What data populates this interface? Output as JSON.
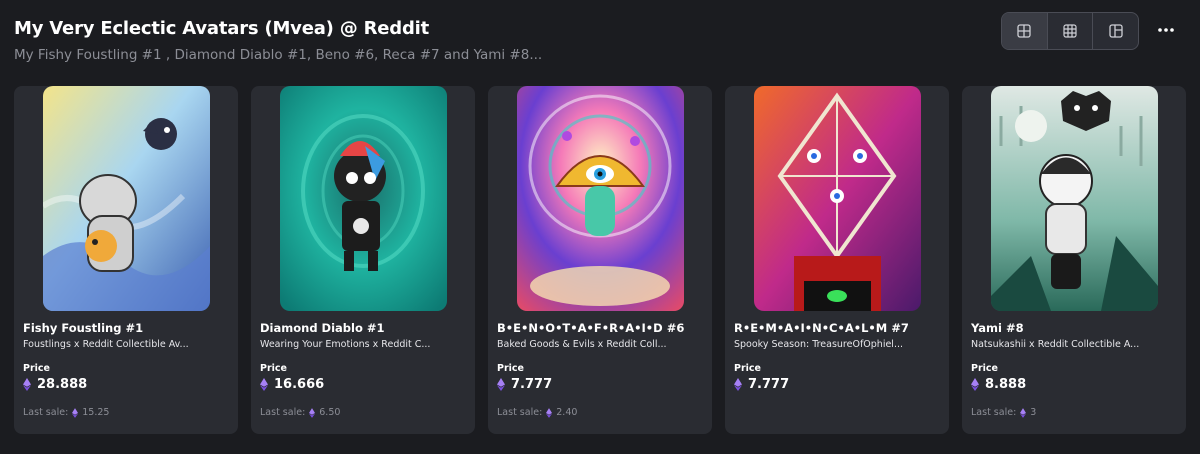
{
  "header": {
    "title": "My Very Eclectic Avatars (Mvea) @ Reddit",
    "subtitle": "My Fishy Foustling #1 , Diamond Diablo #1, Beno #6, Reca #7 and Yami #8..."
  },
  "toolbar": {
    "views": [
      {
        "icon": "grid-large-icon"
      },
      {
        "icon": "grid-small-icon"
      },
      {
        "icon": "layout-mosaic-icon"
      }
    ],
    "more_icon": "more-horizontal-icon"
  },
  "colors": {
    "accent": "#8a5cf6",
    "card_bg": "#2a2c32",
    "page_bg": "#1b1c20"
  },
  "price_label": "Price",
  "last_sale_label": "Last sale:",
  "cards": [
    {
      "name": "Fishy Foustling #1",
      "collection": "Foustlings x Reddit Collectible Av...",
      "price": "28.888",
      "last_sale": "15.25"
    },
    {
      "name": "Diamond Diablo #1",
      "collection": "Wearing Your Emotions x Reddit C...",
      "price": "16.666",
      "last_sale": "6.50"
    },
    {
      "name": "B•E•N•O•T•A•F•R•A•I•D #6",
      "collection": "Baked Goods & Evils x Reddit Coll...",
      "price": "7.777",
      "last_sale": "2.40"
    },
    {
      "name": "R•E•M•A•I•N•C•A•L•M #7",
      "collection": "Spooky Season: TreasureOfOphiel...",
      "price": "7.777",
      "last_sale": ""
    },
    {
      "name": "Yami #8",
      "collection": "Natsukashii x Reddit Collectible A...",
      "price": "8.888",
      "last_sale": "3"
    }
  ]
}
